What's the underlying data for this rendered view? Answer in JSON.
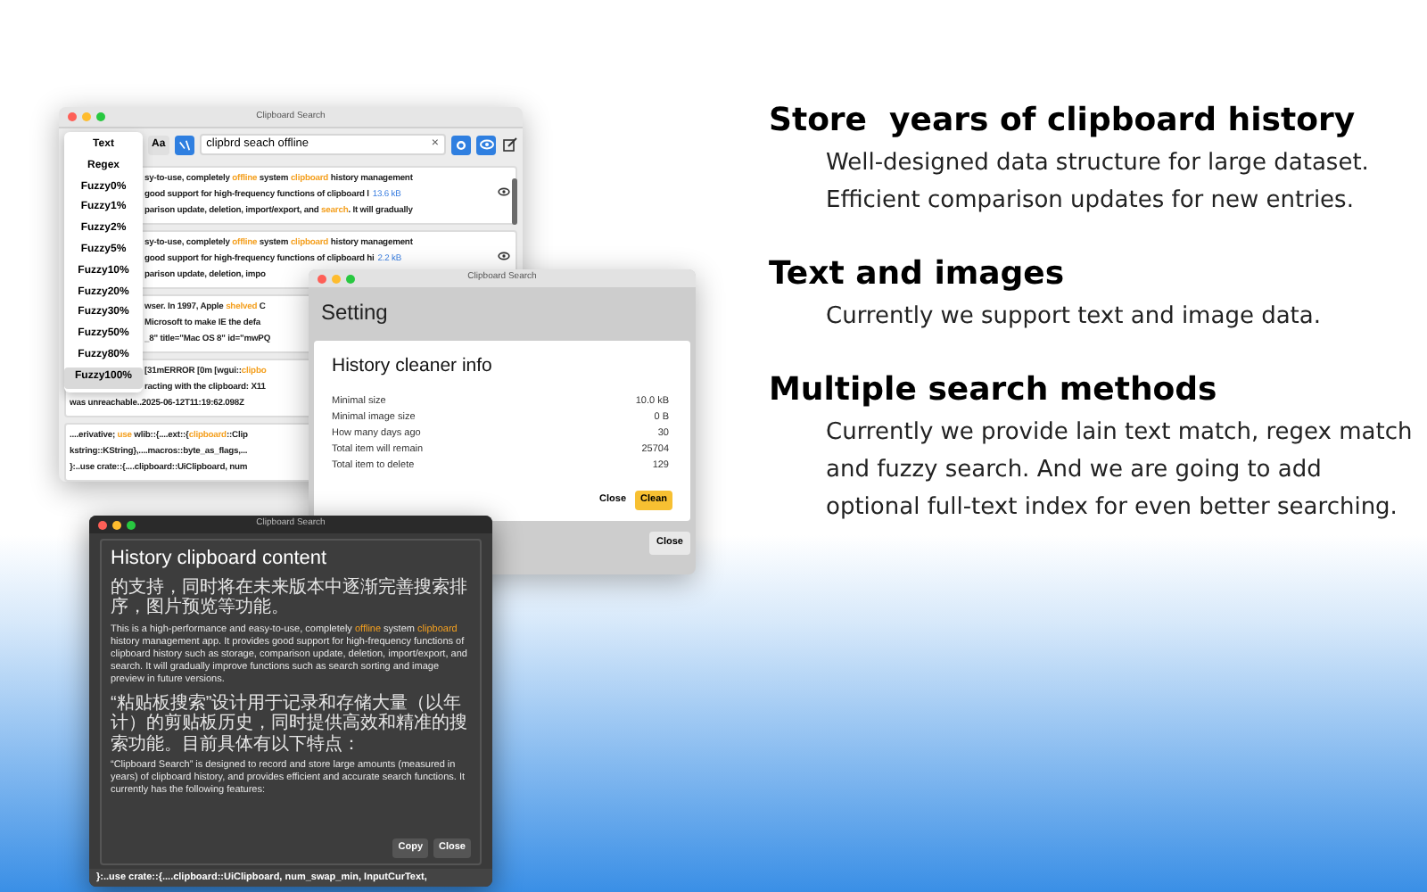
{
  "features": [
    {
      "heading": "Store  years of clipboard history",
      "body": [
        "Well-designed data structure for large dataset.",
        "Efficient comparison updates for new entries."
      ]
    },
    {
      "heading": "Text and images",
      "body": [
        "Currently we support text and image data."
      ]
    },
    {
      "heading": "Multiple search methods",
      "body": [
        "Currently we provide lain text match, regex match and fuzzy search. And we are going to add optional full-text index for even better searching."
      ]
    }
  ],
  "search_window": {
    "title": "Clipboard Search",
    "case_button": "Aa",
    "query": "clipbrd seach offline",
    "clear": "×",
    "mode_menu": [
      {
        "label": "Text",
        "selected": false
      },
      {
        "label": "Regex",
        "selected": false
      },
      {
        "label": "Fuzzy0%",
        "selected": false
      },
      {
        "label": "Fuzzy1%",
        "selected": false
      },
      {
        "label": "Fuzzy2%",
        "selected": false
      },
      {
        "label": "Fuzzy5%",
        "selected": false
      },
      {
        "label": "Fuzzy10%",
        "selected": false
      },
      {
        "label": "Fuzzy20%",
        "selected": false
      },
      {
        "label": "Fuzzy30%",
        "selected": false
      },
      {
        "label": "Fuzzy50%",
        "selected": false
      },
      {
        "label": "Fuzzy80%",
        "selected": false
      },
      {
        "label": "Fuzzy100%",
        "selected": true
      }
    ],
    "entries": [
      {
        "lines": [
          [
            {
              "text": "sy-to-use, completely ",
              "match": false
            },
            {
              "text": "offline",
              "match": true
            },
            {
              "text": " system ",
              "match": false
            },
            {
              "text": "clipboard",
              "match": true
            },
            {
              "text": " history management",
              "match": false
            }
          ],
          [
            {
              "text": "good support for high-frequency functions of clipboard l",
              "match": false
            }
          ],
          [
            {
              "text": "parison update, deletion, import/export, and ",
              "match": false
            },
            {
              "text": "search",
              "match": true
            },
            {
              "text": ". It will gradually",
              "match": false
            }
          ]
        ],
        "size": "13.6 kB"
      },
      {
        "lines": [
          [
            {
              "text": "sy-to-use, completely ",
              "match": false
            },
            {
              "text": "offline",
              "match": true
            },
            {
              "text": " system ",
              "match": false
            },
            {
              "text": "clipboard",
              "match": true
            },
            {
              "text": " history management",
              "match": false
            }
          ],
          [
            {
              "text": "good support for high-frequency functions of clipboard hi",
              "match": false
            }
          ],
          [
            {
              "text": "parison update, deletion, impo",
              "match": false
            }
          ]
        ],
        "size": "2.2 kB"
      },
      {
        "lines": [
          [
            {
              "text": "wser. In 1997, Apple ",
              "match": false
            },
            {
              "text": "shelved",
              "match": true
            },
            {
              "text": " C",
              "match": false
            }
          ],
          [
            {
              "text": "Microsoft to make IE the defa",
              "match": false
            }
          ],
          [
            {
              "text": "_8\" title=\"Mac OS 8\" id=\"mwPQ",
              "match": false
            }
          ]
        ]
      },
      {
        "lines": [
          [
            {
              "text": "[31mERROR [0m [wgui::",
              "match": false
            },
            {
              "text": "clipbo",
              "match": true
            }
          ],
          [
            {
              "text": "racting with the clipboard: X11",
              "match": false
            }
          ],
          [
            {
              "text": "was unreachable..2025-06-12T11:19:62.098Z",
              "match": false
            }
          ]
        ]
      },
      {
        "lines": [
          [
            {
              "text": "....erivative; ",
              "match": false
            },
            {
              "text": "use",
              "match": true
            },
            {
              "text": " wlib::{....ext::{",
              "match": false
            },
            {
              "text": "clipboard",
              "match": true
            },
            {
              "text": "::Clip",
              "match": false
            }
          ],
          [
            {
              "text": "kstring::KString},....macros::byte_as_flags,...",
              "match": false
            }
          ],
          [
            {
              "text": "}:..use crate::{....clipboard::UiClipboard, num",
              "match": false
            }
          ]
        ]
      }
    ]
  },
  "setting_window": {
    "title": "Clipboard Search",
    "heading": "Setting",
    "dialog": {
      "title": "History cleaner info",
      "rows": [
        {
          "label": "Minimal size",
          "value": "10.0 kB"
        },
        {
          "label": "Minimal image size",
          "value": "0 B"
        },
        {
          "label": "How many days ago",
          "value": "30"
        },
        {
          "label": "Total item will remain",
          "value": "25704"
        },
        {
          "label": "Total item to delete",
          "value": "129"
        }
      ],
      "buttons": [
        {
          "label": "Close",
          "kind": "plain"
        },
        {
          "label": "Clean",
          "kind": "primary"
        }
      ]
    },
    "close_button": "Close"
  },
  "content_window": {
    "title": "Clipboard Search",
    "dialog": {
      "title": "History clipboard content",
      "paragraphs": [
        [
          {
            "text": "的支持，同时将在未来版本中逐渐完善搜索排序，图片预览等功能。",
            "match": false
          }
        ],
        [
          {
            "text": "This is a high-performance and easy-to-use, completely ",
            "match": false
          },
          {
            "text": "offline",
            "match": true
          },
          {
            "text": " system ",
            "match": false
          },
          {
            "text": "clipboard",
            "match": true
          },
          {
            "text": " history management app. It provides good support for high-frequency functions of clipboard history such as storage, comparison update, deletion, import/export, and search. It will gradually improve functions such as search sorting and image preview in future versions.",
            "match": false
          }
        ],
        [
          {
            "text": "“粘贴板搜索”设计用于记录和存储大量（以年计）的剪贴板历史，同时提供高效和精准的搜索功能。目前具体有以下特点：",
            "match": false
          }
        ],
        [
          {
            "text": "“Clipboard Search” is designed to record and store large amounts (measured in years) of clipboard history, and provides efficient and accurate search functions. It currently has the following features:",
            "match": false
          }
        ]
      ],
      "buttons": [
        "Copy",
        "Close"
      ]
    },
    "status_line": "}:..use crate::{....clipboard::UiClipboard, num_swap_min, InputCurText,"
  }
}
